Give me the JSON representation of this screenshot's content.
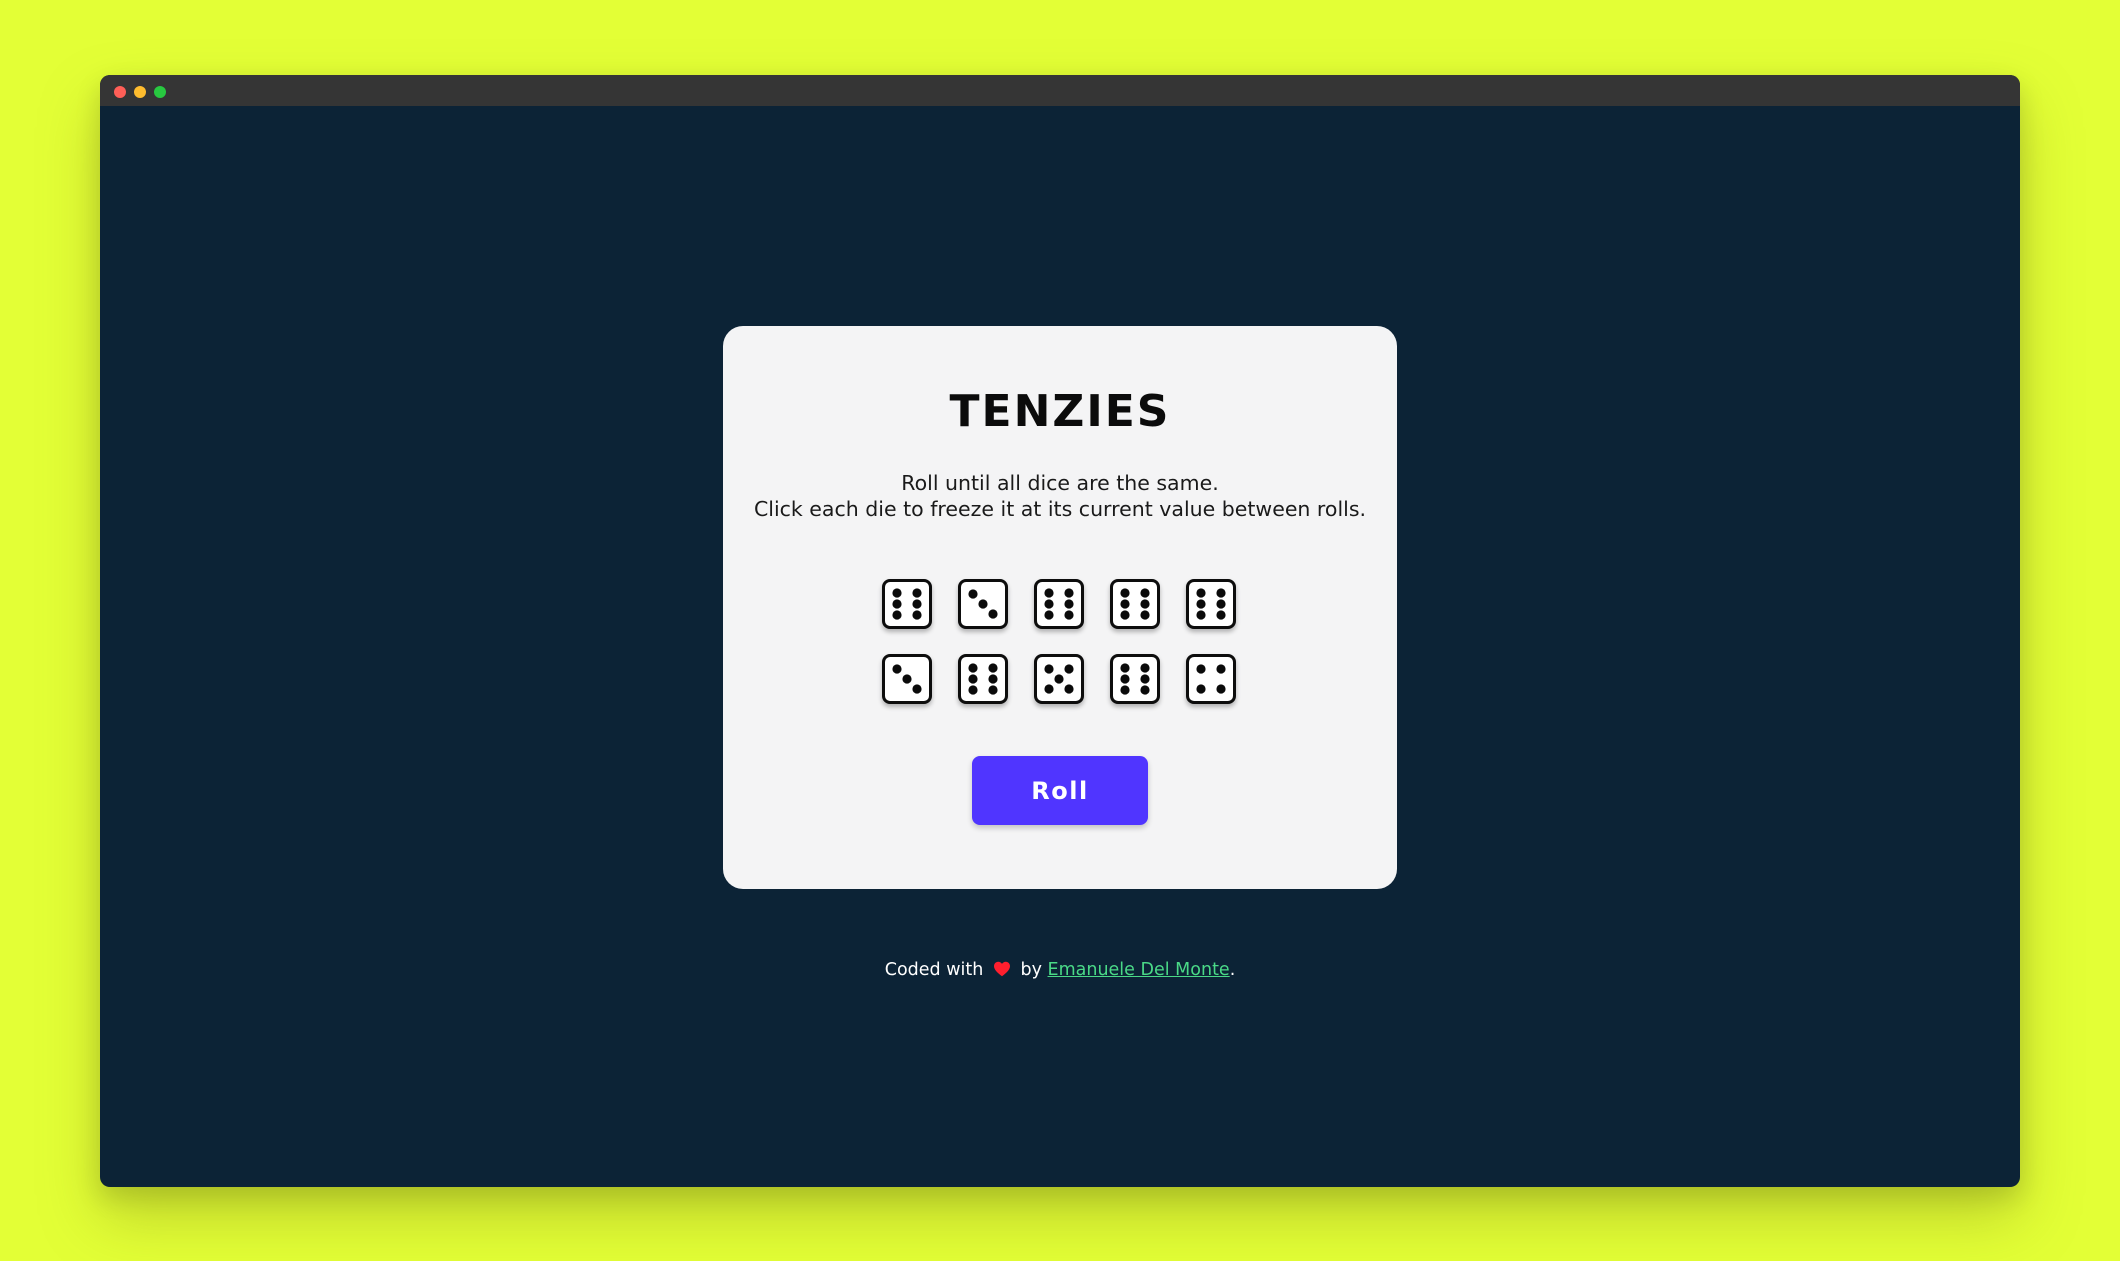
{
  "window": {
    "traffic_lights": [
      "close",
      "minimize",
      "maximize"
    ]
  },
  "game": {
    "title": "TENZIES",
    "instructions": [
      "Roll until all dice are the same.",
      "Click each die to freeze it at its current value between rolls."
    ],
    "dice": [
      6,
      3,
      6,
      6,
      6,
      3,
      6,
      5,
      6,
      4
    ],
    "roll_button_label": "Roll"
  },
  "footer": {
    "prefix": "Coded with",
    "heart_icon": "heart-icon",
    "by_text": "by",
    "author_link": "Emanuele Del Monte",
    "suffix": "."
  },
  "colors": {
    "background": "#e3ff36",
    "window_bg": "#0c2336",
    "card_bg": "#f4f4f5",
    "accent": "#5035ff",
    "link": "#4ad987",
    "heart": "#ff1f2e"
  }
}
